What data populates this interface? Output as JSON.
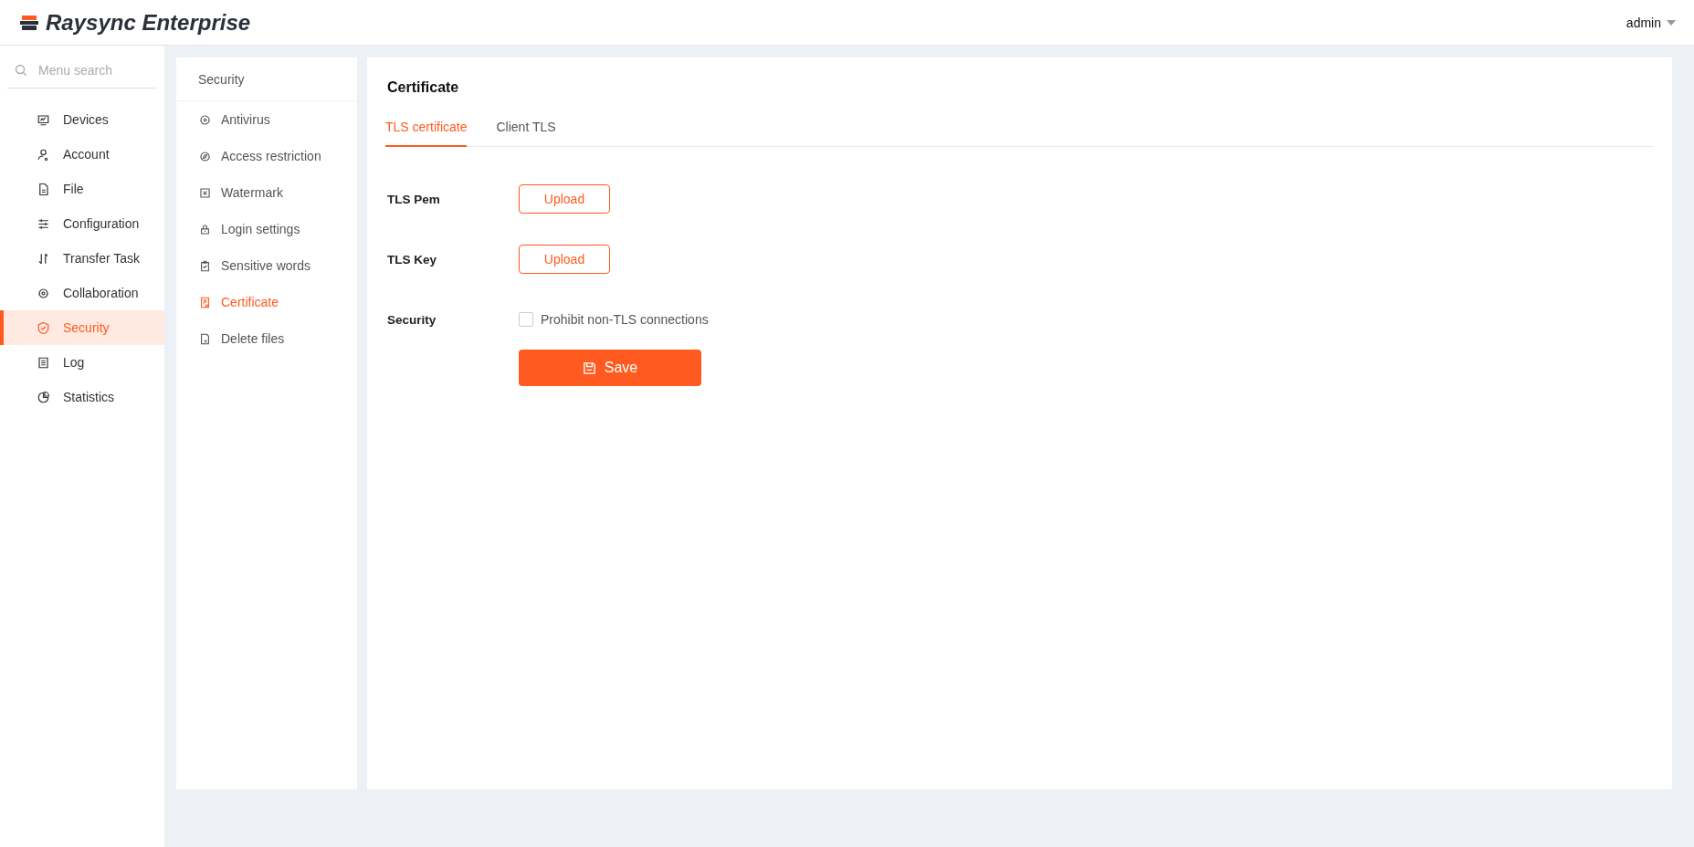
{
  "header": {
    "brand": "Raysync Enterprise",
    "user": "admin"
  },
  "sidebar": {
    "search_placeholder": "Menu search",
    "items": [
      {
        "label": "Devices",
        "selected": false
      },
      {
        "label": "Account",
        "selected": false
      },
      {
        "label": "File",
        "selected": false
      },
      {
        "label": "Configuration",
        "selected": false
      },
      {
        "label": "Transfer Task",
        "selected": false
      },
      {
        "label": "Collaboration",
        "selected": false
      },
      {
        "label": "Security",
        "selected": true
      },
      {
        "label": "Log",
        "selected": false
      },
      {
        "label": "Statistics",
        "selected": false
      }
    ]
  },
  "subnav": {
    "title": "Security",
    "items": [
      {
        "label": "Antivirus",
        "selected": false
      },
      {
        "label": "Access restriction",
        "selected": false
      },
      {
        "label": "Watermark",
        "selected": false
      },
      {
        "label": "Login settings",
        "selected": false
      },
      {
        "label": "Sensitive words",
        "selected": false
      },
      {
        "label": "Certificate",
        "selected": true
      },
      {
        "label": "Delete files",
        "selected": false
      }
    ]
  },
  "main": {
    "title": "Certificate",
    "tabs": [
      {
        "label": "TLS certificate",
        "selected": true
      },
      {
        "label": "Client TLS",
        "selected": false
      }
    ],
    "form": [
      {
        "kind": "upload",
        "label": "TLS Pem",
        "button": "Upload"
      },
      {
        "kind": "upload",
        "label": "TLS Key",
        "button": "Upload"
      },
      {
        "kind": "checkbox",
        "label": "Security",
        "text": "Prohibit non-TLS connections",
        "checked": false
      }
    ],
    "save": "Save"
  }
}
